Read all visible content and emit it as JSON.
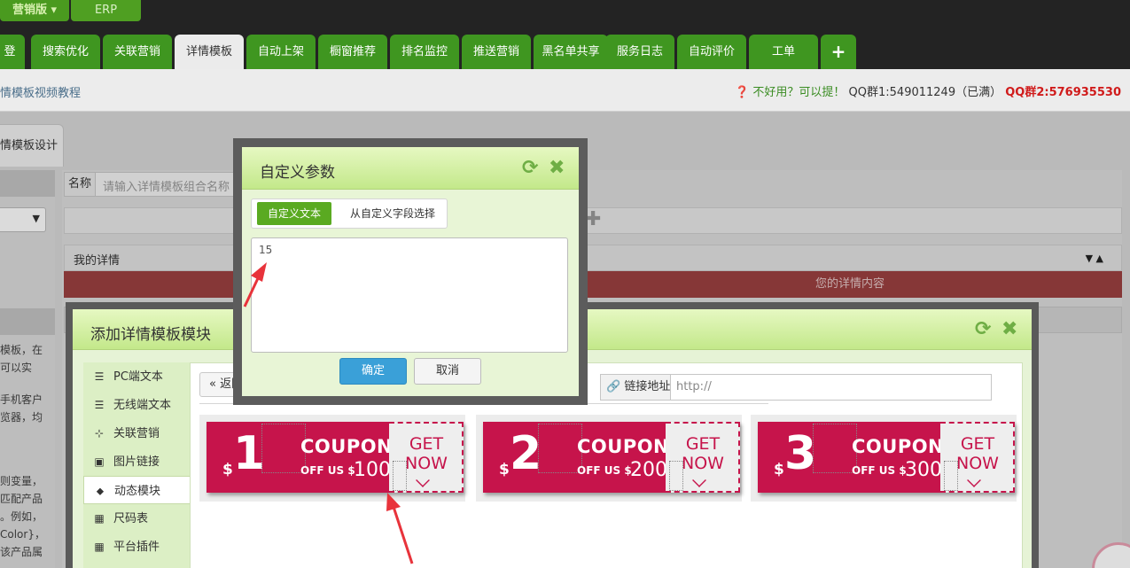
{
  "top": {
    "version_marketing": "营销版",
    "version_erp": "ERP",
    "tabs": [
      {
        "label": "登",
        "active": false
      },
      {
        "label": "搜索优化",
        "active": false
      },
      {
        "label": "关联营销",
        "active": false
      },
      {
        "label": "详情模板",
        "active": true
      },
      {
        "label": "自动上架",
        "active": false
      },
      {
        "label": "橱窗推荐",
        "active": false
      },
      {
        "label": "排名监控",
        "active": false
      },
      {
        "label": "推送营销",
        "active": false
      },
      {
        "label": "黑名单共享",
        "active": false
      },
      {
        "label": "服务日志",
        "active": false
      },
      {
        "label": "自动评价",
        "active": false
      },
      {
        "label": "工单",
        "active": false
      },
      {
        "label": "+",
        "active": false
      }
    ]
  },
  "infobar": {
    "video_link": "情模板视频教程",
    "help_prefix": "不好用？可以提！",
    "qq1": "QQ群1:549011249（已满）",
    "qq2": "QQ群2:576935530"
  },
  "page": {
    "design_tab": "情模板设计",
    "name_label": "名称",
    "name_placeholder": "请输入详情模板组合名称",
    "mine_label": "我的详情",
    "red_notice": "您的详情内容",
    "left_lines_1": [
      "模板，在",
      "可以实"
    ],
    "left_lines_2": [
      "手机客户",
      "览器，均"
    ],
    "left_lines_3": [
      "则变量，",
      "匹配产品",
      "。例如，",
      "Color}，",
      "该产品属"
    ]
  },
  "module_dialog": {
    "title": "添加详情模板模块",
    "menu": [
      {
        "label": "PC端文本",
        "icon": "align-left-icon",
        "active": false
      },
      {
        "label": "无线端文本",
        "icon": "align-left-icon",
        "active": false
      },
      {
        "label": "关联营销",
        "icon": "sitemap-icon",
        "active": false
      },
      {
        "label": "图片链接",
        "icon": "image-icon",
        "active": false
      },
      {
        "label": "动态模块",
        "icon": "tag-icon",
        "active": true
      },
      {
        "label": "尺码表",
        "icon": "table-icon",
        "active": false
      },
      {
        "label": "平台插件",
        "icon": "table-icon",
        "active": false
      }
    ],
    "back_label": "« 返回",
    "link_label": "链接地址",
    "link_value": "http://",
    "coupons": [
      {
        "currency": "$",
        "value": "1",
        "heading": "COUPON",
        "off_text": "OFF US $",
        "min_spend": "100",
        "cta_line1": "GET",
        "cta_line2": "NOW"
      },
      {
        "currency": "$",
        "value": "2",
        "heading": "COUPON",
        "off_text": "OFF US $",
        "min_spend": "200",
        "cta_line1": "GET",
        "cta_line2": "NOW"
      },
      {
        "currency": "$",
        "value": "3",
        "heading": "COUPON",
        "off_text": "OFF US $",
        "min_spend": "300",
        "cta_line1": "GET",
        "cta_line2": "NOW"
      }
    ]
  },
  "param_dialog": {
    "title": "自定义参数",
    "tab_custom_text": "自定义文本",
    "tab_custom_field": "从自定义字段选择",
    "text_value": "15",
    "ok_label": "确定",
    "cancel_label": "取消"
  },
  "colors": {
    "tab_green": "#3f9620",
    "coupon_red": "#c6144b",
    "annotation_red": "#e8333b",
    "primary_blue": "#3aa0d8"
  }
}
